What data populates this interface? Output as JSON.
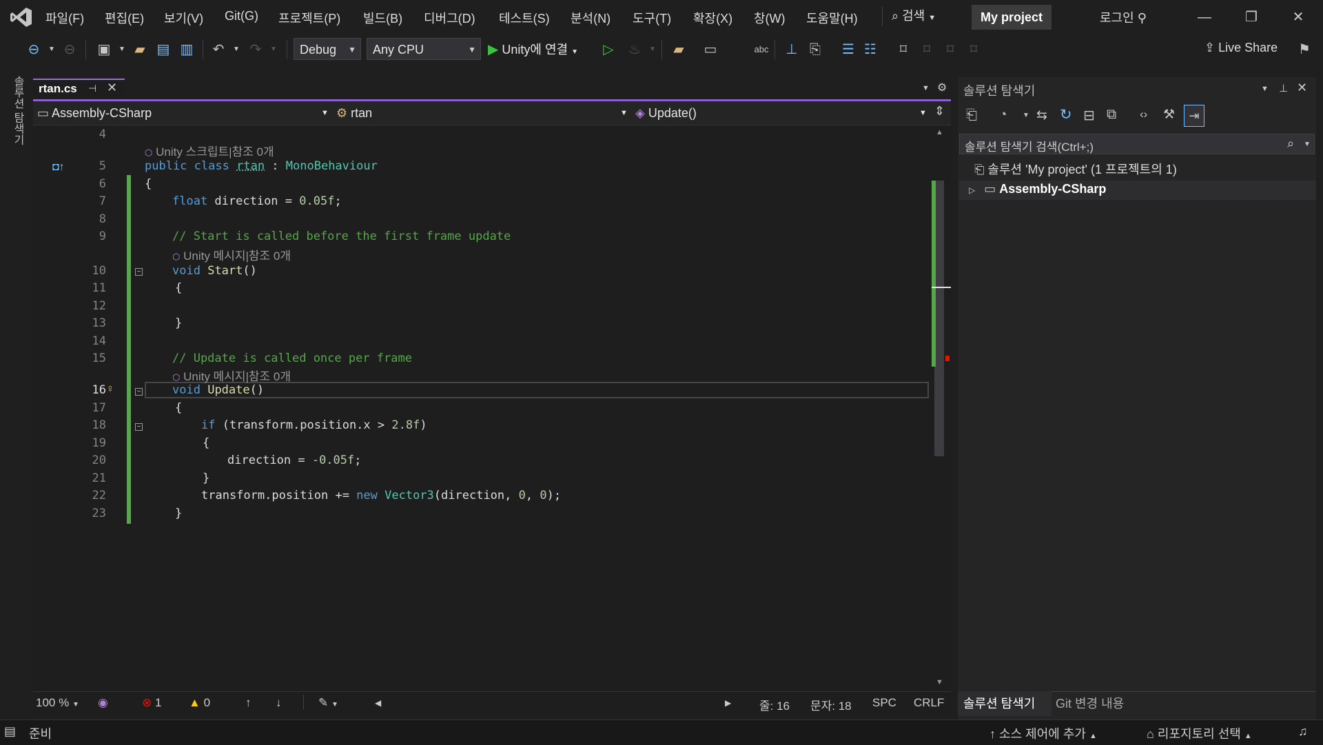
{
  "menu": [
    "파일(F)",
    "편집(E)",
    "보기(V)",
    "Git(G)",
    "프로젝트(P)",
    "빌드(B)",
    "디버그(D)",
    "테스트(S)",
    "분석(N)",
    "도구(T)",
    "확장(X)",
    "창(W)",
    "도움말(H)"
  ],
  "title_bar": {
    "search_label": "검색",
    "project_name": "My project",
    "login_label": "로그인"
  },
  "toolbar": {
    "config": "Debug",
    "platform": "Any CPU",
    "run_label": "Unity에 연결",
    "live_share": "Live Share"
  },
  "side_tab_label": "솔루션 탐색기",
  "editor": {
    "tab_name": "rtan.cs",
    "nav": {
      "project": "Assembly-CSharp",
      "class": "rtan",
      "member": "Update()"
    },
    "lens_lines": {
      "l5": "Unity 스크립트|참조 0개",
      "l10": "Unity 메시지|참조 0개",
      "l16": "Unity 메시지|참조 0개"
    },
    "line_numbers": [
      "4",
      "5",
      "6",
      "7",
      "8",
      "9",
      "10",
      "11",
      "12",
      "13",
      "14",
      "15",
      "16",
      "17",
      "18",
      "19",
      "20",
      "21",
      "22",
      "23"
    ],
    "code": {
      "l5_kw1": "public",
      "l5_kw2": "class",
      "l5_name": "rtan",
      "l5_sep": " : ",
      "l5_base": "MonoBehaviour",
      "l6": "{",
      "l7_kw": "float",
      "l7_rest": " direction = ",
      "l7_num": "0.05f",
      "l7_end": ";",
      "l9": "// Start is called before the first frame update",
      "l10_kw": "void",
      "l10_fn": "Start",
      "l10_end": "()",
      "l11": "{",
      "l13": "}",
      "l15": "// Update is called once per frame",
      "l16_kw": "void",
      "l16_fn": "Update",
      "l16_end": "()",
      "l17": "{",
      "l18_kw": "if",
      "l18_rest": " (transform.position.x > ",
      "l18_num": "2.8f",
      "l18_end": ")",
      "l19": "{",
      "l20_rest": "direction = ",
      "l20_num": "-0.05f",
      "l20_end": ";",
      "l21": "}",
      "l22_a": "transform.position += ",
      "l22_kw": "new",
      "l22_ty": "Vector3",
      "l22_b": "(direction, ",
      "l22_n1": "0",
      "l22_c": ", ",
      "l22_n2": "0",
      "l22_d": ");",
      "l23": "}"
    },
    "status": {
      "zoom": "100 %",
      "errors": "1",
      "warnings": "0",
      "line": "줄: 16",
      "char": "문자: 18",
      "spc": "SPC",
      "crlf": "CRLF"
    }
  },
  "solution_explorer": {
    "title": "솔루션 탐색기",
    "search_placeholder": "솔루션 탐색기 검색(Ctrl+;)",
    "solution_node": "솔루션 'My project' (1 프로젝트의 1)",
    "project_node": "Assembly-CSharp",
    "tabs": [
      "솔루션 탐색기",
      "Git 변경 내용"
    ]
  },
  "statusbar": {
    "ready": "준비",
    "source_control": "소스 제어에 추가",
    "repo": "리포지토리 선택"
  },
  "colors": {
    "accent": "#8e5fd2",
    "keyword": "#569cd6",
    "type": "#4ec9b0",
    "comment": "#57a64a",
    "number": "#b5cea8"
  }
}
